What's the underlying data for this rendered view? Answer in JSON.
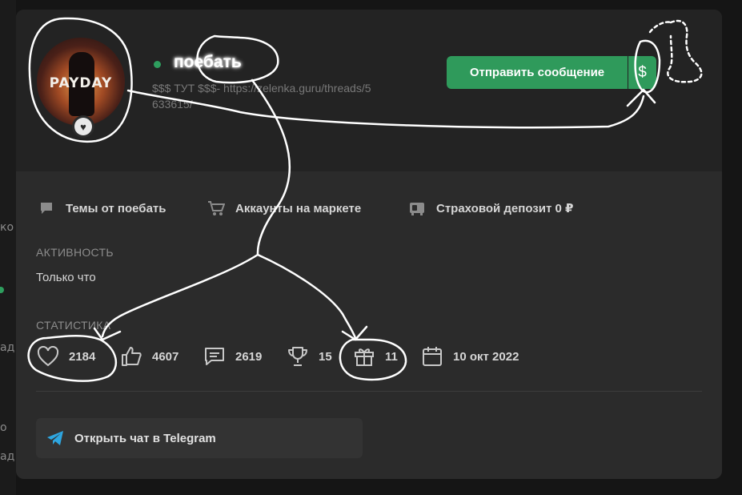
{
  "profile": {
    "username": "поебать",
    "status": "$$$ ТУТ $$$- https://zelenka.guru/threads/5633615/",
    "avatar_text": "PAYDAY",
    "avatar_icon": "heart-icon",
    "online_color": "#2e9e5e"
  },
  "actions": {
    "send_message_label": "Отправить сообщение",
    "money_label": "$",
    "accent_color": "#2f9a5b"
  },
  "nav": [
    {
      "label": "Темы от поебать",
      "icon": "chat-bubble-icon"
    },
    {
      "label": "Аккаунты на маркете",
      "icon": "cart-icon"
    },
    {
      "label": "Страховой депозит 0 ₽",
      "icon": "deposit-icon"
    }
  ],
  "activity": {
    "label": "АКТИВНОСТЬ",
    "value": "Только что"
  },
  "stats": {
    "label": "СТАТИСТИКА",
    "items": [
      {
        "value": "2184",
        "icon": "heart-outline-icon"
      },
      {
        "value": "4607",
        "icon": "thumbs-up-icon"
      },
      {
        "value": "2619",
        "icon": "message-icon"
      },
      {
        "value": "15",
        "icon": "trophy-icon"
      },
      {
        "value": "11",
        "icon": "gift-icon"
      },
      {
        "value": "10 окт 2022",
        "icon": "calendar-icon"
      }
    ]
  },
  "telegram": {
    "label": "Открыть чат в Telegram",
    "icon": "telegram-icon",
    "icon_color": "#2ea6e0"
  },
  "background": {
    "edge_texts": [
      "ко",
      "ад",
      "о",
      "ад"
    ]
  }
}
